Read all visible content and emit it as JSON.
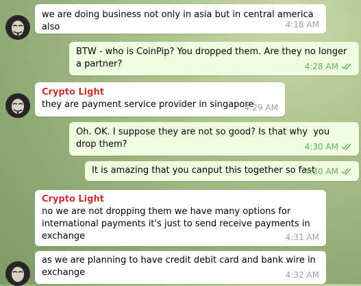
{
  "messages": [
    {
      "sender": "",
      "text": "we are doing business not only in asia but in central america also",
      "time": "4:18 AM"
    },
    {
      "text": "BTW - who is CoinPip? You dropped them. Are they no longer a partner?",
      "time": "4:28 AM"
    },
    {
      "sender": "Crypto Light",
      "text": "they are payment service provider in singapore",
      "time": "4:29 AM"
    },
    {
      "text": "Oh. OK. I suppose they are not so good? Is that why  you drop them?",
      "time": "4:30 AM"
    },
    {
      "text": "It is amazing that you canput this together so fast",
      "time": "4:30 AM"
    },
    {
      "sender": "Crypto Light",
      "text": "no we are not dropping them we have many options for international payments it's just to send receive payments in exchange",
      "time": "4:31 AM"
    },
    {
      "text": "as we are planning to have credit debit card and bank wire in exchange",
      "time": "4:32 AM"
    }
  ],
  "colors": {
    "incoming": "#ffffff",
    "outgoing": "#effdde",
    "sender": "#c8322f",
    "tick": "#5fb462"
  },
  "icons": {
    "avatar": "masked-face-avatar",
    "read": "double-check-icon"
  }
}
